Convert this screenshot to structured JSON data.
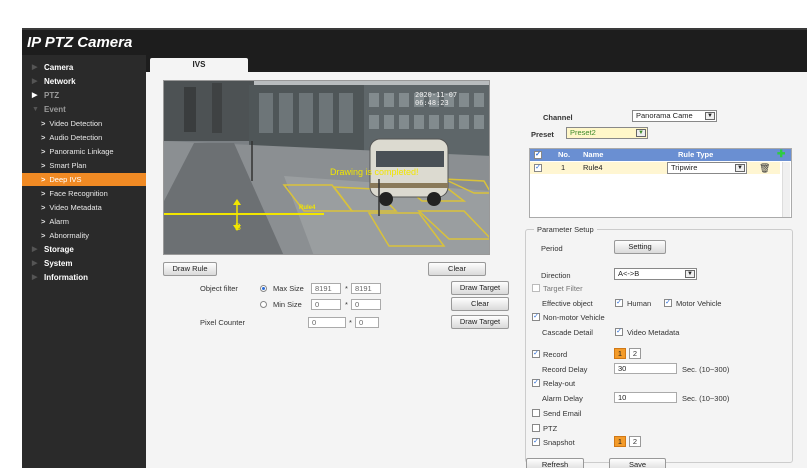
{
  "app": {
    "title": "IP PTZ Camera"
  },
  "sidebar": {
    "sections": [
      {
        "label": "Camera"
      },
      {
        "label": "Network"
      },
      {
        "label": "PTZ"
      },
      {
        "label": "Event"
      },
      {
        "label": "Storage"
      },
      {
        "label": "System"
      },
      {
        "label": "Information"
      }
    ],
    "event_items": [
      {
        "label": "Video Detection"
      },
      {
        "label": "Audio Detection"
      },
      {
        "label": "Panoramic Linkage"
      },
      {
        "label": "Smart Plan"
      },
      {
        "label": "Deep IVS"
      },
      {
        "label": "Face Recognition"
      },
      {
        "label": "Video Metadata"
      },
      {
        "label": "Alarm"
      },
      {
        "label": "Abnormality"
      }
    ]
  },
  "tab": {
    "label": "IVS"
  },
  "video": {
    "timestamp": "2020-11-07 06:48:23",
    "overlay_text": "Drawing is completed!",
    "rule_tag": "Rule4",
    "marker": "B"
  },
  "left_controls": {
    "draw_rule": "Draw Rule",
    "clear_1": "Clear",
    "object_filter_label": "Object filter",
    "max_size_label": "Max Size",
    "max_w": "8191",
    "max_h": "8191",
    "draw_target_1": "Draw Target",
    "min_size_label": "Min Size",
    "min_w": "0",
    "min_h": "0",
    "clear_2": "Clear",
    "pixel_counter_label": "Pixel Counter",
    "px_w": "0",
    "px_h": "0",
    "draw_target_2": "Draw Target",
    "times": "*"
  },
  "right": {
    "channel_label": "Channel",
    "channel_value": "Panorama Came",
    "preset_label": "Preset",
    "preset_value": "Preset2",
    "rules_header": {
      "no": "No.",
      "name": "Name",
      "type": "Rule Type"
    },
    "rules": [
      {
        "no": "1",
        "name": "Rule4",
        "type": "Tripwire"
      }
    ]
  },
  "params": {
    "legend": "Parameter Setup",
    "period_label": "Period",
    "setting_button": "Setting",
    "direction_label": "Direction",
    "direction_value": "A<->B",
    "target_filter": "Target Filter",
    "effective_object": "Effective object",
    "human": "Human",
    "motor_vehicle": "Motor Vehicle",
    "non_motor": "Non-motor Vehicle",
    "cascade_detail": "Cascade Detail",
    "video_metadata": "Video Metadata",
    "record": "Record",
    "record_delay_label": "Record Delay",
    "record_delay_value": "30",
    "record_delay_unit": "Sec. (10~300)",
    "relay_out": "Relay-out",
    "alarm_delay_label": "Alarm Delay",
    "alarm_delay_value": "10",
    "alarm_delay_unit": "Sec. (10~300)",
    "send_email": "Send Email",
    "ptz": "PTZ",
    "snapshot": "Snapshot",
    "ch1": "1",
    "ch2": "2"
  },
  "footer": {
    "refresh": "Refresh",
    "save": "Save"
  },
  "colors": {
    "accent": "#f08a24",
    "banner": "#1d1d1d",
    "sidebar": "#2a2a2a",
    "table_header": "#6a8fd2",
    "overlay": "#f2e600"
  },
  "icons": {
    "add": "plus-circle-icon",
    "delete": "trash-icon",
    "dropdown": "chevron-down-icon"
  }
}
